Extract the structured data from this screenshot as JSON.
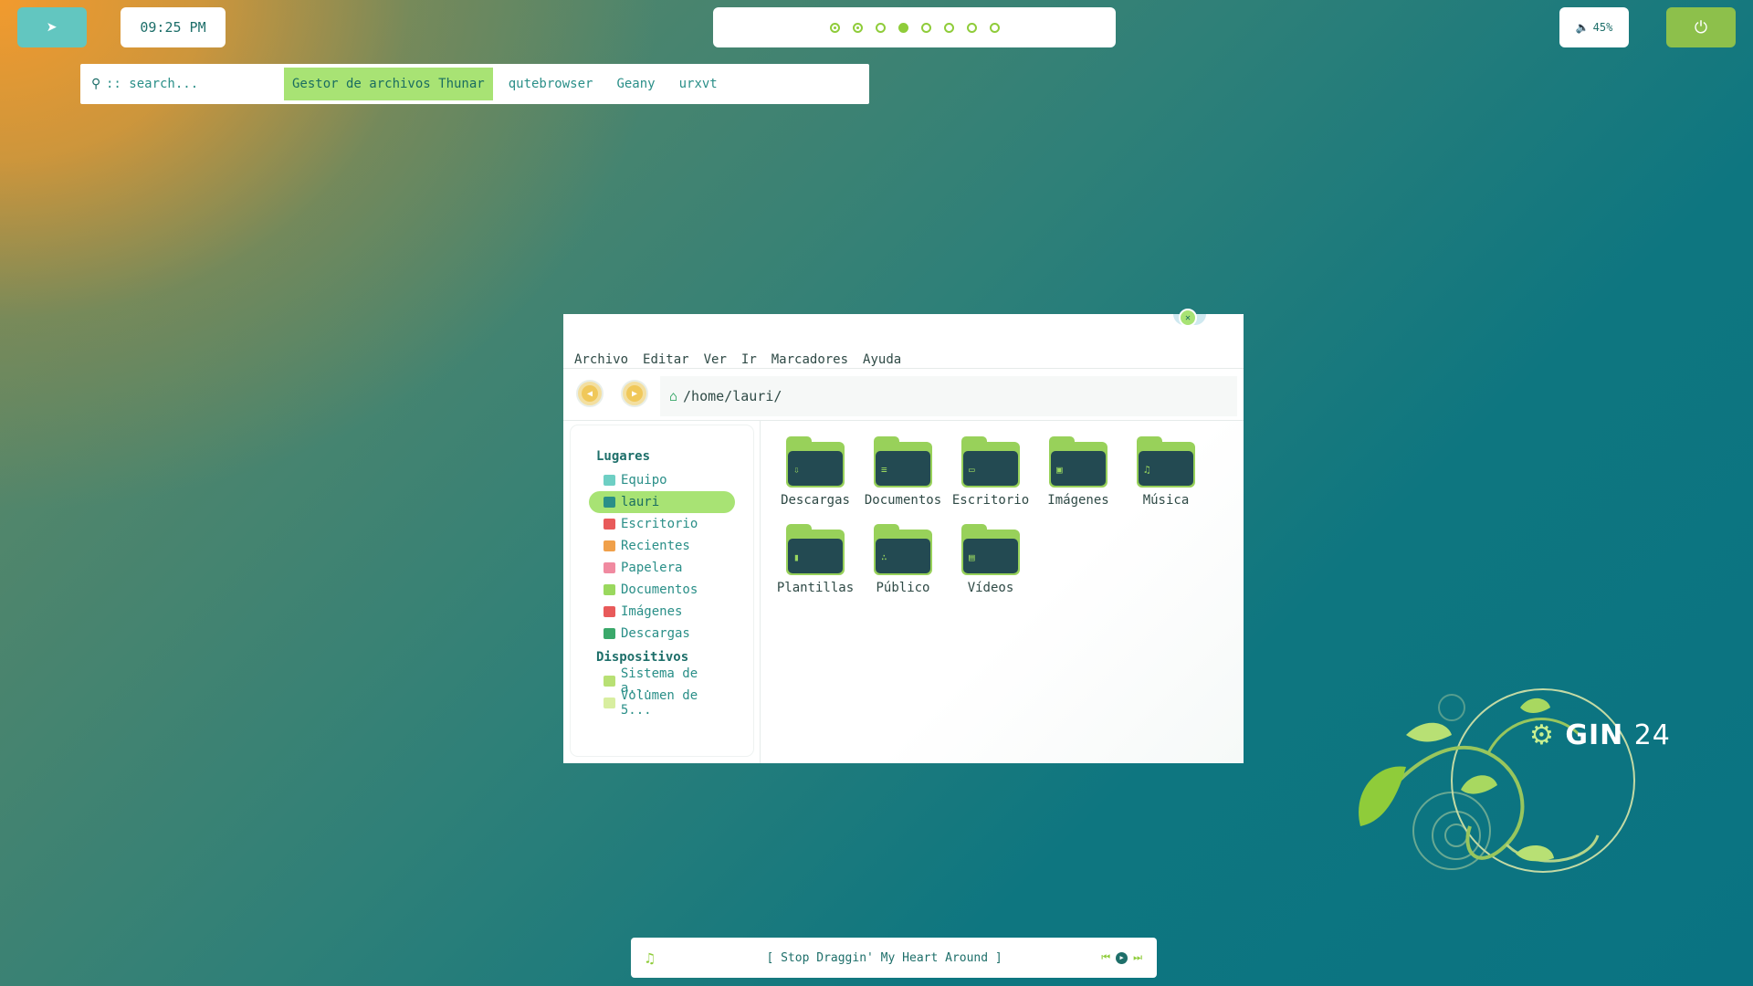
{
  "topbar": {
    "launcher_icon": "arrow-up-icon",
    "clock": "09:25 PM",
    "workspaces": [
      {
        "state": "dot"
      },
      {
        "state": "dot"
      },
      {
        "state": "empty"
      },
      {
        "state": "active"
      },
      {
        "state": "empty"
      },
      {
        "state": "empty"
      },
      {
        "state": "empty"
      },
      {
        "state": "empty"
      }
    ],
    "volume": "45%",
    "power_icon": "power-icon"
  },
  "launcher": {
    "placeholder": ":: search...",
    "items": [
      "Gestor de archivos Thunar",
      "qutebrowser",
      "Geany",
      "urxvt"
    ],
    "selected_index": 0
  },
  "file_manager": {
    "menu": [
      "Archivo",
      "Editar",
      "Ver",
      "Ir",
      "Marcadores",
      "Ayuda"
    ],
    "path": "/home/lauri/",
    "sidebar": {
      "places_heading": "Lugares",
      "places": [
        {
          "label": "Equipo",
          "color": "#6ecfc4"
        },
        {
          "label": "lauri",
          "color": "#2a8f88",
          "selected": true
        },
        {
          "label": "Escritorio",
          "color": "#e85a5a"
        },
        {
          "label": "Recientes",
          "color": "#f0a04a"
        },
        {
          "label": "Papelera",
          "color": "#f08aa0"
        },
        {
          "label": "Documentos",
          "color": "#9ad85e"
        },
        {
          "label": "Imágenes",
          "color": "#e85a5a"
        },
        {
          "label": "Descargas",
          "color": "#3aa86a"
        }
      ],
      "devices_heading": "Dispositivos",
      "devices": [
        {
          "label": "Sistema de a...",
          "color": "#b8e074"
        },
        {
          "label": "Volumen de 5...",
          "color": "#d8eea0"
        }
      ]
    },
    "folders": [
      {
        "label": "Descargas",
        "icon": "download-icon"
      },
      {
        "label": "Documentos",
        "icon": "document-icon"
      },
      {
        "label": "Escritorio",
        "icon": "desktop-icon"
      },
      {
        "label": "Imágenes",
        "icon": "image-icon"
      },
      {
        "label": "Música",
        "icon": "music-icon"
      },
      {
        "label": "Plantillas",
        "icon": "template-icon"
      },
      {
        "label": "Público",
        "icon": "share-icon"
      },
      {
        "label": "Vídeos",
        "icon": "video-icon"
      }
    ]
  },
  "music": {
    "song": "[ Stop Draggin' My Heart Around ]"
  },
  "logo": {
    "text": "GIN",
    "number": "24"
  }
}
